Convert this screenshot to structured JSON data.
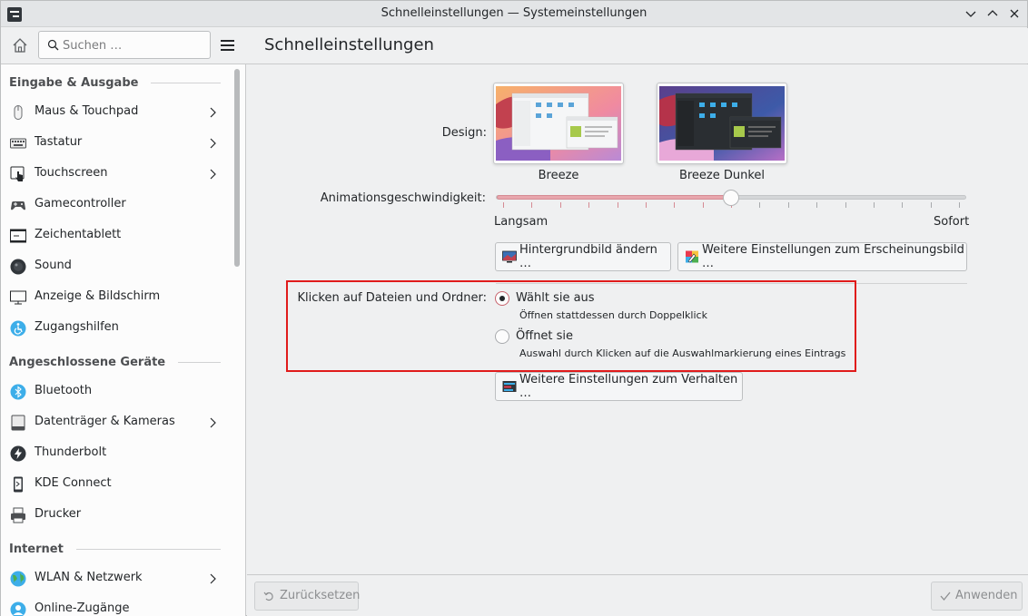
{
  "window": {
    "title": "Schnelleinstellungen — Systemeinstellungen",
    "controls": [
      "minimize",
      "maximize",
      "close"
    ]
  },
  "search": {
    "placeholder": "Suchen …"
  },
  "page": {
    "title": "Schnelleinstellungen"
  },
  "sidebar": {
    "sections": [
      {
        "title": "Eingabe & Ausgabe",
        "items": [
          {
            "label": "Maus & Touchpad",
            "icon": "mouse-icon",
            "has_children": true
          },
          {
            "label": "Tastatur",
            "icon": "keyboard-icon",
            "has_children": true
          },
          {
            "label": "Touchscreen",
            "icon": "touchscreen-icon",
            "has_children": true
          },
          {
            "label": "Gamecontroller",
            "icon": "gamepad-icon",
            "has_children": false
          },
          {
            "label": "Zeichentablett",
            "icon": "tablet-icon",
            "has_children": false
          },
          {
            "label": "Sound",
            "icon": "speaker-icon",
            "has_children": false
          },
          {
            "label": "Anzeige & Bildschirm",
            "icon": "monitor-icon",
            "has_children": false
          },
          {
            "label": "Zugangshilfen",
            "icon": "accessibility-icon",
            "has_children": false
          }
        ]
      },
      {
        "title": "Angeschlossene Geräte",
        "items": [
          {
            "label": "Bluetooth",
            "icon": "bluetooth-icon",
            "has_children": false
          },
          {
            "label": "Datenträger & Kameras",
            "icon": "drive-icon",
            "has_children": true
          },
          {
            "label": "Thunderbolt",
            "icon": "thunderbolt-icon",
            "has_children": false
          },
          {
            "label": "KDE Connect",
            "icon": "phone-icon",
            "has_children": false
          },
          {
            "label": "Drucker",
            "icon": "printer-icon",
            "has_children": false
          }
        ]
      },
      {
        "title": "Internet",
        "items": [
          {
            "label": "WLAN & Netzwerk",
            "icon": "globe-icon",
            "has_children": true
          },
          {
            "label": "Online-Zugänge",
            "icon": "online-accounts-icon",
            "has_children": false
          }
        ]
      }
    ]
  },
  "design": {
    "label": "Design:",
    "themes": [
      {
        "caption": "Breeze",
        "selected": true
      },
      {
        "caption": "Breeze Dunkel",
        "selected": false
      }
    ]
  },
  "animation": {
    "label": "Animationsgeschwindigkeit:",
    "min_label": "Langsam",
    "max_label": "Sofort",
    "value_fraction": 0.5,
    "tick_count": 17
  },
  "appearance_buttons": {
    "wallpaper": "Hintergrundbild ändern …",
    "more_appearance": "Weitere Einstellungen zum Erscheinungsbild …"
  },
  "click_behavior": {
    "label": "Klicken auf Dateien und Ordner:",
    "options": [
      {
        "label": "Wählt sie aus",
        "hint": "Öffnen stattdessen durch Doppelklick",
        "checked": true
      },
      {
        "label": "Öffnet sie",
        "hint": "Auswahl durch Klicken auf die Auswahlmarkierung eines Eintrags",
        "checked": false
      }
    ],
    "more_button": "Weitere Einstellungen zum Verhalten …"
  },
  "footer": {
    "reset": "Zurücksetzen",
    "apply": "Anwenden"
  },
  "colors": {
    "accent": "#e8a6ad",
    "highlight_box": "#e01b1b"
  }
}
